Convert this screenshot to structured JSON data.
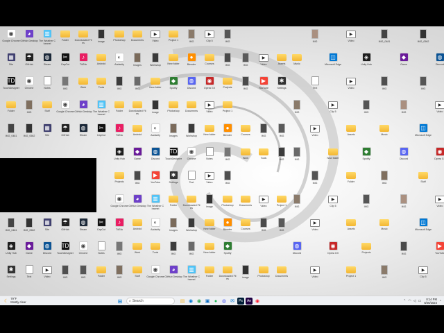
{
  "colors": {
    "folder": "#f3b632",
    "taskbar": "#eef0f3",
    "accent_blue": "#0078d4"
  },
  "icons": [
    {
      "glyph": "app",
      "color": "#ffffff",
      "symbol": "◉",
      "label": "Google Chrome"
    },
    {
      "glyph": "app",
      "color": "#6e40c9",
      "symbol": "◕",
      "label": "GitHub Desktop"
    },
    {
      "glyph": "app",
      "color": "#4fc3f7",
      "symbol": "▥",
      "label": "The Weather Channel"
    },
    {
      "glyph": "folder",
      "label": "Folder"
    },
    {
      "glyph": "folder",
      "label": "Downloaded Files"
    },
    {
      "glyph": "photo",
      "color": "#333",
      "label": "image"
    },
    {
      "glyph": "folder",
      "label": "Photoshop"
    },
    {
      "glyph": "folder",
      "label": "Documents"
    },
    {
      "glyph": "vid",
      "symbol": "▶",
      "label": "Video"
    },
    {
      "glyph": "folder",
      "label": "Project 1"
    },
    {
      "glyph": "photo",
      "color": "#8a7a6a",
      "label": "IMG"
    },
    {
      "glyph": "vid",
      "symbol": "▶",
      "label": "Clip 5"
    },
    {
      "glyph": "photo",
      "color": "#555",
      "label": "IMG"
    },
    {
      "glyph": "photo",
      "color": "#aa9080",
      "label": "IMG"
    },
    {
      "glyph": "vid",
      "symbol": "▶",
      "label": "Video"
    },
    {
      "glyph": "photo",
      "color": "#444",
      "label": "IMG_0481"
    },
    {
      "glyph": "photo",
      "color": "#333",
      "label": "IMG_0562"
    },
    {
      "glyph": "app",
      "color": "#3f3f6f",
      "symbol": "▦",
      "label": "Site"
    },
    {
      "glyph": "app",
      "color": "#222",
      "symbol": "☂",
      "label": "GitHub"
    },
    {
      "glyph": "app",
      "color": "#1b2838",
      "symbol": "◍",
      "label": "Steam"
    },
    {
      "glyph": "app",
      "color": "#111",
      "symbol": "✂",
      "label": "CapCut"
    },
    {
      "glyph": "app",
      "color": "#e91e63",
      "symbol": "♪",
      "label": "TikTok"
    },
    {
      "glyph": "folder",
      "label": "Android"
    },
    {
      "glyph": "app",
      "color": "#ffffff",
      "symbol": "◐",
      "label": "Audacity"
    },
    {
      "glyph": "photo",
      "color": "#7a6a5a",
      "label": "Images"
    },
    {
      "glyph": "photo",
      "color": "#3a3a3a",
      "label": "Workshop"
    },
    {
      "glyph": "folder",
      "label": "New folder"
    },
    {
      "glyph": "app",
      "color": "#ff8f00",
      "symbol": "●",
      "label": "Blender"
    },
    {
      "glyph": "folder",
      "label": "Courses"
    },
    {
      "glyph": "photo",
      "color": "#4a4a4a",
      "label": "IMG"
    },
    {
      "glyph": "photo",
      "color": "#5a5a5a",
      "label": "IMG"
    },
    {
      "glyph": "vid",
      "symbol": "▶",
      "label": "Video"
    },
    {
      "glyph": "folder",
      "label": "Assets"
    },
    {
      "glyph": "folder",
      "label": "Music"
    },
    {
      "glyph": "app",
      "color": "#0078d4",
      "symbol": "◫",
      "label": "Microsoft Edge"
    },
    {
      "glyph": "app",
      "color": "#1e1e1e",
      "symbol": "◈",
      "label": "Unity Hub"
    },
    {
      "glyph": "app",
      "color": "#6a1b9a",
      "symbol": "◆",
      "label": "Game"
    },
    {
      "glyph": "app",
      "color": "#0b5394",
      "symbol": "◍",
      "label": "Discord"
    },
    {
      "glyph": "app",
      "color": "#111",
      "symbol": "TD",
      "label": "TouchDesigner"
    },
    {
      "glyph": "app",
      "color": "#fff",
      "symbol": "◉",
      "label": "Chrome"
    },
    {
      "glyph": "doc",
      "label": "Notes"
    },
    {
      "glyph": "photo",
      "color": "#777",
      "label": "IMG"
    },
    {
      "glyph": "folder",
      "label": "Work"
    },
    {
      "glyph": "folder",
      "label": "Tools"
    },
    {
      "glyph": "photo",
      "color": "#3c3c3c",
      "label": "IMG"
    },
    {
      "glyph": "photo",
      "color": "#6a6a6a",
      "label": "IMG"
    },
    {
      "glyph": "folder",
      "label": "New folder"
    },
    {
      "glyph": "app",
      "color": "#2e7d32",
      "symbol": "◆",
      "label": "Spotify"
    },
    {
      "glyph": "app",
      "color": "#5865f2",
      "symbol": "◍",
      "label": "Discord"
    },
    {
      "glyph": "app",
      "color": "#c62828",
      "symbol": "◉",
      "label": "Opera GX"
    },
    {
      "glyph": "folder",
      "label": "Projects"
    },
    {
      "glyph": "photo",
      "color": "#4a4a4a",
      "label": "IMG"
    },
    {
      "glyph": "app",
      "color": "#f44336",
      "symbol": "▶",
      "label": "YouTube"
    },
    {
      "glyph": "app",
      "color": "#333",
      "symbol": "✱",
      "label": "Settings"
    },
    {
      "glyph": "doc",
      "label": "Text"
    },
    {
      "glyph": "vid",
      "symbol": "▶",
      "label": "Video"
    },
    {
      "glyph": "photo",
      "color": "#4f4f4f",
      "label": "IMG"
    },
    {
      "glyph": "photo",
      "color": "#555",
      "label": "IMG"
    },
    {
      "glyph": "folder",
      "label": "Folder"
    },
    {
      "glyph": "photo",
      "color": "#7f6f5f",
      "label": "IMG"
    },
    {
      "glyph": "folder",
      "label": "Stuff"
    }
  ],
  "taskbar": {
    "weather_temp": "79°F",
    "weather_desc": "Mostly clear",
    "search_placeholder": "Search",
    "time": "8:14 PM",
    "date": "8/26/2024",
    "pinned": [
      {
        "name": "file-explorer-icon",
        "symbol": "▤",
        "color": "#f3b632"
      },
      {
        "name": "edge-icon",
        "symbol": "◉",
        "color": "#0078d4"
      },
      {
        "name": "chrome-icon",
        "symbol": "◉",
        "color": "#34a853"
      },
      {
        "name": "store-icon",
        "symbol": "▣",
        "color": "#0067c0"
      },
      {
        "name": "spotify-icon",
        "symbol": "●",
        "color": "#1db954"
      },
      {
        "name": "discord-icon",
        "symbol": "◍",
        "color": "#5865f2"
      },
      {
        "name": "mail-icon",
        "symbol": "✉",
        "color": "#0078d4"
      },
      {
        "name": "photoshop-icon",
        "symbol": "Ps",
        "color": "#001e36"
      },
      {
        "name": "aftereffects-icon",
        "symbol": "Ae",
        "color": "#1f0040"
      },
      {
        "name": "opera-icon",
        "symbol": "◉",
        "color": "#ff1b2d"
      }
    ]
  }
}
